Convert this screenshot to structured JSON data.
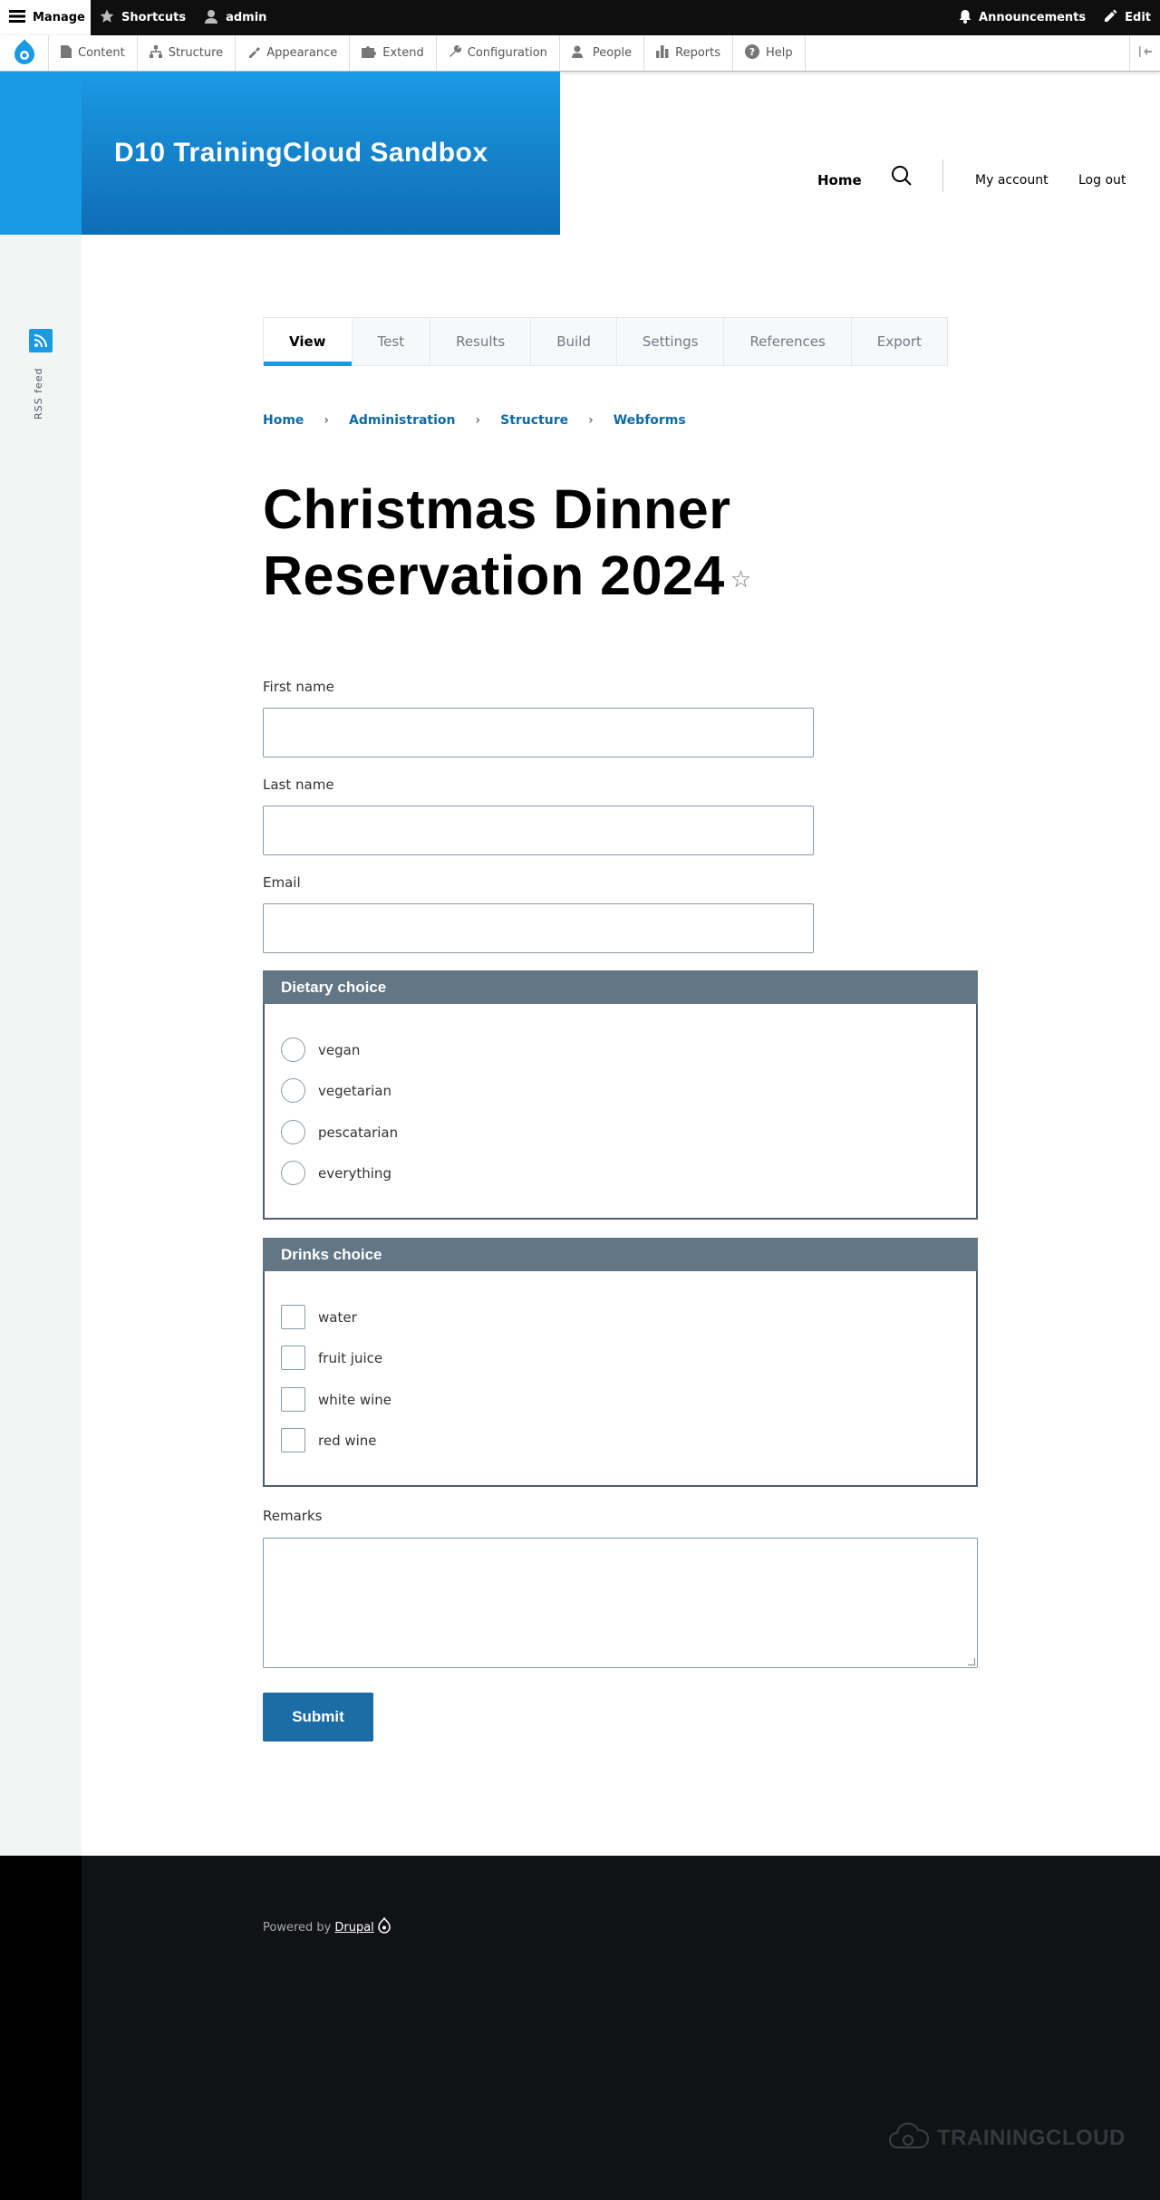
{
  "toolbar": {
    "manage": "Manage",
    "shortcuts": "Shortcuts",
    "user": "admin",
    "announcements": "Announcements",
    "edit": "Edit"
  },
  "tray": {
    "items": [
      "Content",
      "Structure",
      "Appearance",
      "Extend",
      "Configuration",
      "People",
      "Reports",
      "Help"
    ]
  },
  "header": {
    "site_name": "D10 TrainingCloud Sandbox",
    "nav_home": "Home",
    "my_account": "My account",
    "log_out": "Log out"
  },
  "rail": {
    "rss_label": "RSS feed"
  },
  "tabs": [
    "View",
    "Test",
    "Results",
    "Build",
    "Settings",
    "References",
    "Export"
  ],
  "breadcrumb": [
    "Home",
    "Administration",
    "Structure",
    "Webforms"
  ],
  "page_title": "Christmas Dinner Reservation 2024",
  "form": {
    "first_name_label": "First name",
    "last_name_label": "Last name",
    "email_label": "Email",
    "dietary": {
      "legend": "Dietary choice",
      "options": [
        "vegan",
        "vegetarian",
        "pescatarian",
        "everything"
      ]
    },
    "drinks": {
      "legend": "Drinks choice",
      "options": [
        "water",
        "fruit juice",
        "white wine",
        "red wine"
      ]
    },
    "remarks_label": "Remarks",
    "submit_label": "Submit"
  },
  "footer": {
    "powered_by": "Powered by",
    "drupal_link": "Drupal",
    "brand": "TRAININGCLOUD"
  },
  "colors": {
    "accent": "#1b9ae4",
    "header_dark": "#0f6cb5",
    "link": "#0d6ba8",
    "fieldset_legend": "#637685",
    "submit": "#1a6da6",
    "footer": "#111215"
  }
}
